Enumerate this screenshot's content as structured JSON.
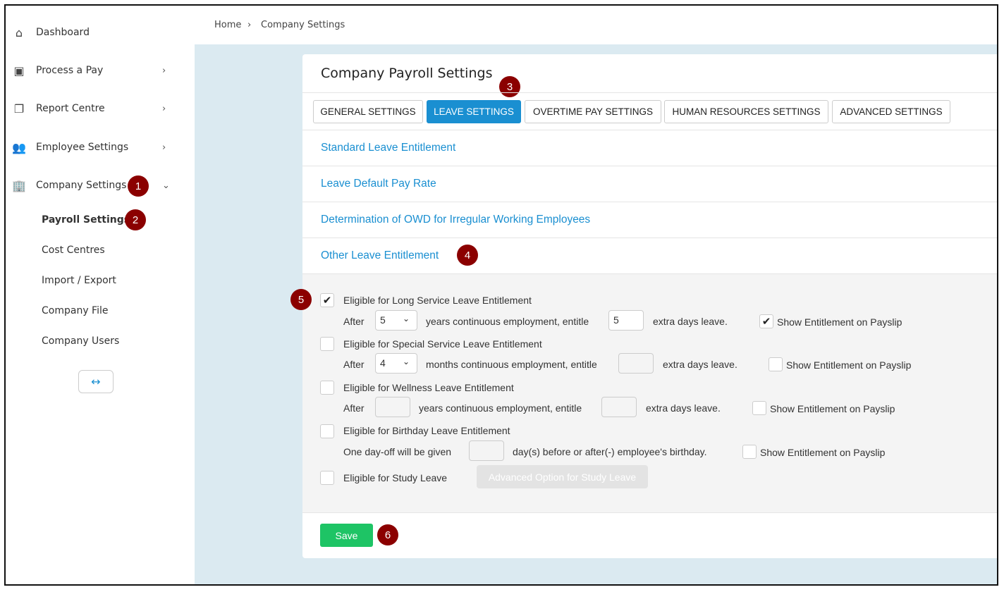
{
  "sidebar": {
    "items": [
      {
        "label": "Dashboard",
        "icon": "home-icon"
      },
      {
        "label": "Process a Pay",
        "icon": "calendar-icon"
      },
      {
        "label": "Report Centre",
        "icon": "documents-icon"
      },
      {
        "label": "Employee Settings",
        "icon": "people-icon"
      },
      {
        "label": "Company Settings",
        "icon": "building-icon"
      }
    ],
    "subitems": [
      "Payroll Settings",
      "Cost Centres",
      "Import / Export",
      "Company File",
      "Company Users"
    ]
  },
  "breadcrumb": {
    "home": "Home",
    "current": "Company Settings"
  },
  "card": {
    "title": "Company Payroll Settings",
    "tabs": [
      "GENERAL SETTINGS",
      "LEAVE SETTINGS",
      "OVERTIME PAY SETTINGS",
      "HUMAN RESOURCES SETTINGS",
      "ADVANCED SETTINGS"
    ],
    "active_tab": "LEAVE SETTINGS",
    "sections": [
      "Standard Leave Entitlement",
      "Leave Default Pay Rate",
      "Determination of OWD for Irregular Working Employees",
      "Other Leave Entitlement"
    ]
  },
  "leave": {
    "long_service": {
      "label": "Eligible for Long Service Leave Entitlement",
      "checked": true,
      "after": "After",
      "years": "5",
      "mid": "years continuous employment, entitle",
      "days": "5",
      "end": "extra days leave.",
      "payslip": "Show Entitlement on Payslip",
      "payslip_checked": true
    },
    "special": {
      "label": "Eligible for Special Service Leave Entitlement",
      "checked": false,
      "after": "After",
      "months": "4",
      "mid": "months continuous employment, entitle",
      "days": "",
      "end": "extra days leave.",
      "payslip": "Show Entitlement on Payslip",
      "payslip_checked": false
    },
    "wellness": {
      "label": "Eligible for Wellness Leave Entitlement",
      "checked": false,
      "after": "After",
      "years": "",
      "mid": "years continuous employment, entitle",
      "days": "",
      "end": "extra days leave.",
      "payslip": "Show Entitlement on Payslip",
      "payslip_checked": false
    },
    "birthday": {
      "label": "Eligible for Birthday Leave Entitlement",
      "checked": false,
      "pre": "One day-off will be given",
      "days": "",
      "post": "day(s) before or after(-) employee's birthday.",
      "payslip": "Show Entitlement on Payslip",
      "payslip_checked": false
    },
    "study": {
      "label": "Eligible for Study Leave",
      "checked": false,
      "advanced": "Advanced Option for Study Leave"
    }
  },
  "save_label": "Save",
  "badges": [
    "1",
    "2",
    "3",
    "4",
    "5",
    "6"
  ],
  "colors": {
    "accent": "#1a8fd1",
    "save": "#1ec465",
    "badge": "#8b0000",
    "background": "#dbeaf1"
  }
}
